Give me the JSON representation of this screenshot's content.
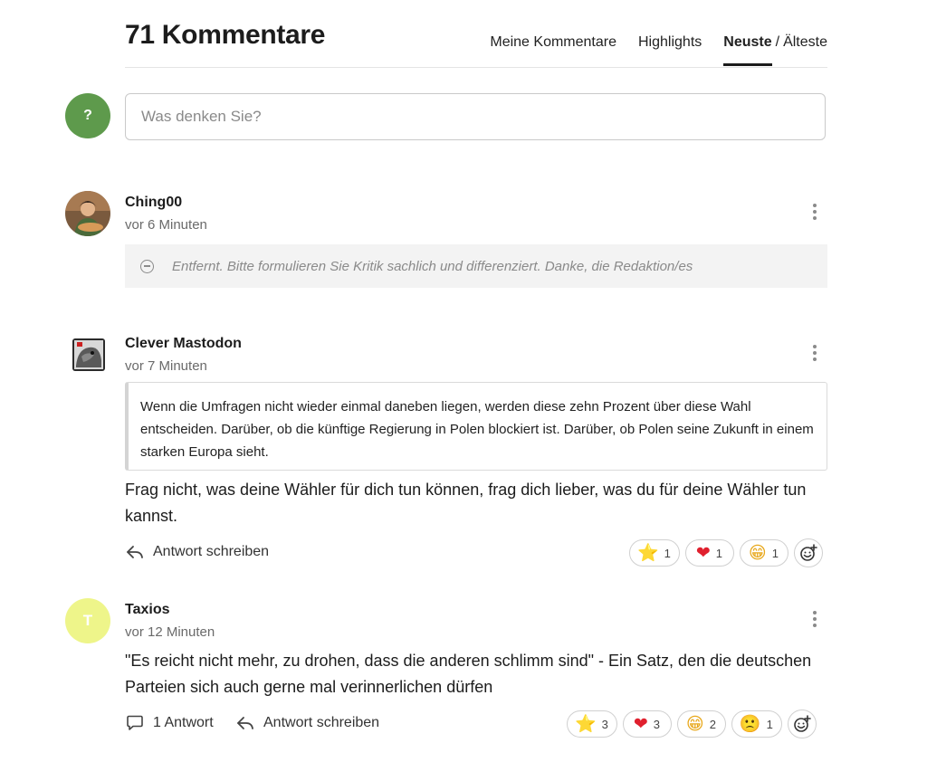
{
  "header": {
    "title": "71 Kommentare",
    "tab_my_comments": "Meine Kommentare",
    "tab_highlights": "Highlights",
    "tab_newest": "Neuste",
    "tab_separator": "/",
    "tab_oldest": "Älteste"
  },
  "compose": {
    "avatar_letter": "?",
    "placeholder": "Was denken Sie?"
  },
  "comments": [
    {
      "author": "Ching00",
      "time": "vor 6 Minuten",
      "removed_text": "Entfernt. Bitte formulieren Sie Kritik sachlich und differenziert. Danke, die Redaktion/es"
    },
    {
      "author": "Clever Mastodon",
      "time": "vor 7 Minuten",
      "quote": "Wenn die Umfragen nicht wieder einmal daneben liegen, werden diese zehn Prozent über diese Wahl entscheiden. Darüber, ob die künftige Regierung in Polen blockiert ist. Darüber, ob Polen seine Zukunft in einem starken Europa sieht.",
      "text": "Frag nicht, was deine Wähler für dich tun können, frag dich lieber, was du für deine Wähler tun kannst.",
      "reply_label": "Antwort schreiben",
      "reactions": [
        {
          "emoji": "⭐",
          "count": "1"
        },
        {
          "emoji": "❤",
          "count": "1"
        },
        {
          "emoji": "😁",
          "count": "1"
        }
      ]
    },
    {
      "author": "Taxios",
      "avatar_letter": "T",
      "time": "vor 12 Minuten",
      "text": "\"Es reicht nicht mehr, zu drohen, dass die anderen schlimm sind\" - Ein Satz, den die deutschen Parteien sich auch gerne mal verinnerlichen dürfen",
      "replies_label": "1 Antwort",
      "reply_label": "Antwort schreiben",
      "reactions": [
        {
          "emoji": "⭐",
          "count": "3"
        },
        {
          "emoji": "❤",
          "count": "3"
        },
        {
          "emoji": "😁",
          "count": "2"
        },
        {
          "emoji": "🙁",
          "count": "1"
        }
      ]
    }
  ],
  "colors": {
    "compose_avatar": "#5e9a4c",
    "taxios_avatar": "#eef58a",
    "star": "#f5c518",
    "heart": "#e0202e"
  }
}
